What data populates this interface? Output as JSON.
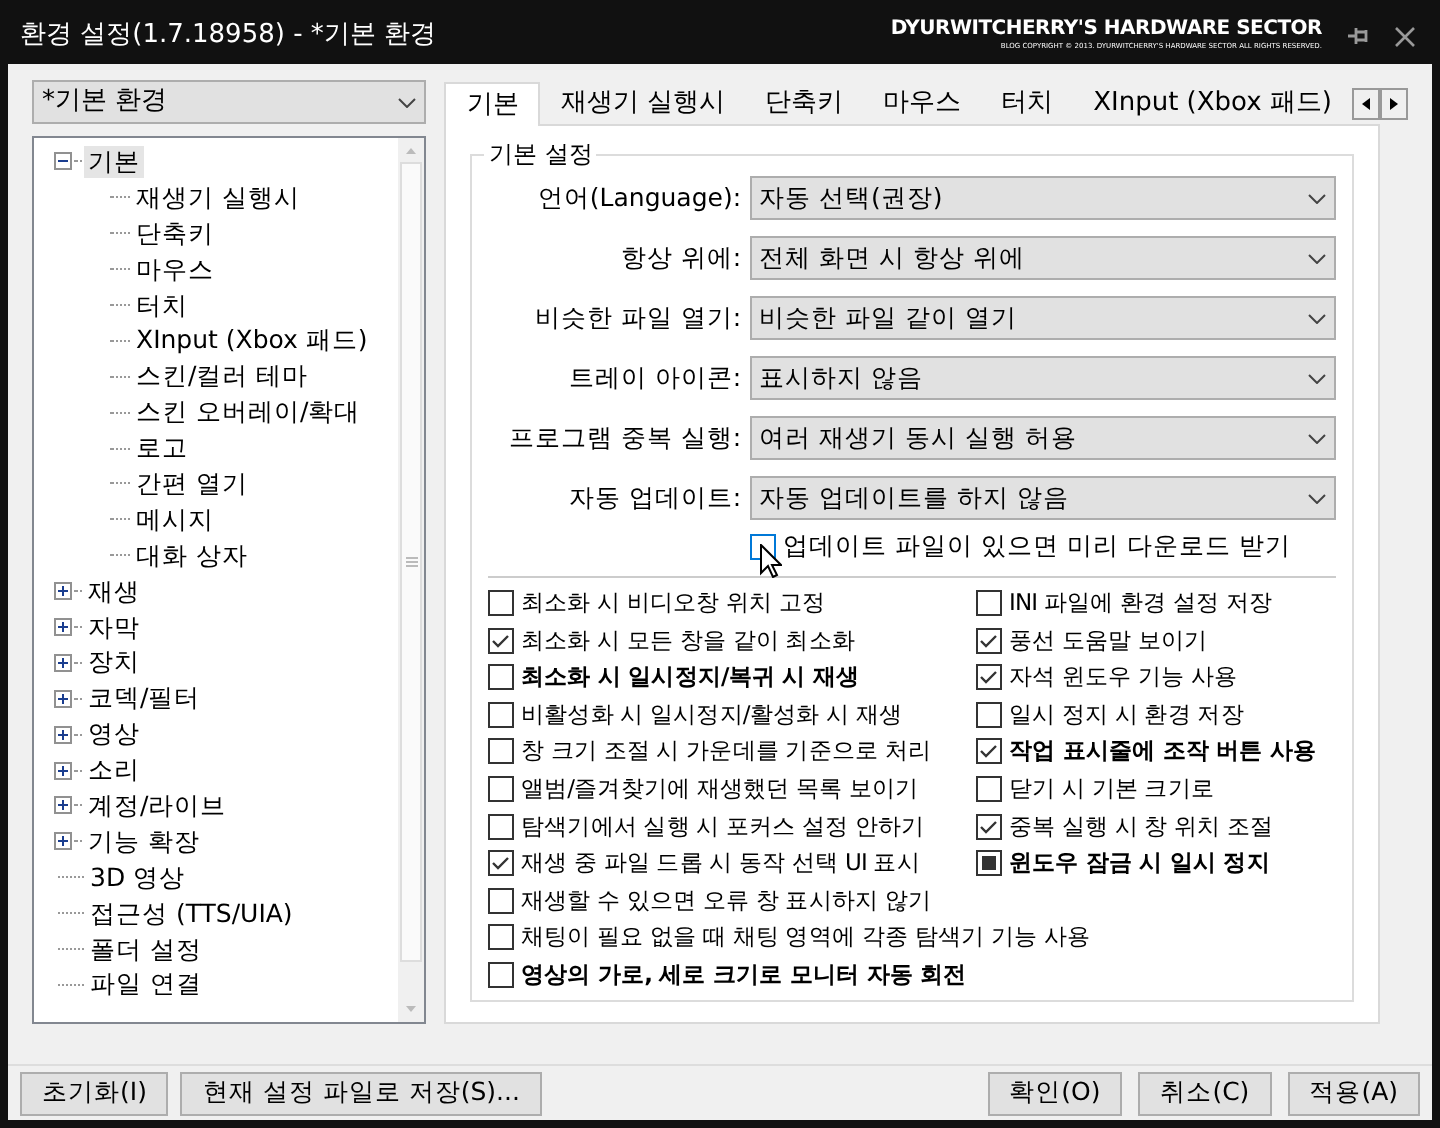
{
  "window": {
    "title": "환경 설정(1.7.18958) - *기본 환경",
    "logo": {
      "name": "DYURWITCHERRY'S HARDWARE SECTOR",
      "tagline": "BLOG COPYRIGHT © 2013. DYURWITCHERRY'S HARDWARE SECTOR ALL RIGHTS RESERVED."
    }
  },
  "profile": {
    "value": "*기본 환경"
  },
  "tree": [
    {
      "label": "기본",
      "selected": true,
      "expanded": true,
      "children": [
        {
          "label": "재생기 실행시",
          "selected": false
        },
        {
          "label": "단축키",
          "selected": false
        },
        {
          "label": "마우스",
          "selected": false
        },
        {
          "label": "터치",
          "selected": false
        },
        {
          "label": "XInput (Xbox 패드)",
          "selected": false
        },
        {
          "label": "스킨/컬러 테마",
          "selected": false
        },
        {
          "label": "스킨 오버레이/확대",
          "selected": false
        },
        {
          "label": "로고",
          "selected": false
        },
        {
          "label": "간편 열기",
          "selected": false
        },
        {
          "label": "메시지",
          "selected": false
        },
        {
          "label": "대화 상자",
          "selected": false
        }
      ]
    },
    {
      "label": "재생",
      "selected": false,
      "expanded": false
    },
    {
      "label": "자막",
      "selected": false,
      "expanded": false
    },
    {
      "label": "장치",
      "selected": false,
      "expanded": false
    },
    {
      "label": "코덱/필터",
      "selected": false,
      "expanded": false
    },
    {
      "label": "영상",
      "selected": false,
      "expanded": false
    },
    {
      "label": "소리",
      "selected": false,
      "expanded": false
    },
    {
      "label": "계정/라이브",
      "selected": false,
      "expanded": false
    },
    {
      "label": "기능 확장",
      "selected": false,
      "expanded": false
    },
    {
      "label": "3D 영상",
      "selected": false
    },
    {
      "label": "접근성 (TTS/UIA)",
      "selected": false
    },
    {
      "label": "폴더 설정",
      "selected": false
    },
    {
      "label": "파일 연결",
      "selected": false
    }
  ],
  "tabs": [
    {
      "label": "기본",
      "selected": true
    },
    {
      "label": "재생기 실행시",
      "selected": false
    },
    {
      "label": "단축키",
      "selected": false
    },
    {
      "label": "마우스",
      "selected": false
    },
    {
      "label": "터치",
      "selected": false
    },
    {
      "label": "XInput (Xbox 패드)",
      "selected": false
    }
  ],
  "group": {
    "title": "기본 설정"
  },
  "settings": [
    {
      "label": "언어(Language):",
      "value": "자동 선택(권장)"
    },
    {
      "label": "항상 위에:",
      "value": "전체 화면 시 항상 위에"
    },
    {
      "label": "비슷한 파일 열기:",
      "value": "비슷한 파일 같이 열기"
    },
    {
      "label": "트레이 아이콘:",
      "value": "표시하지 않음"
    },
    {
      "label": "프로그램 중복 실행:",
      "value": "여러 재생기 동시 실행 허용"
    },
    {
      "label": "자동 업데이트:",
      "value": "자동 업데이트를 하지 않음"
    }
  ],
  "update_option": {
    "label": "업데이트 파일이 있으면 미리 다운로드 받기",
    "checked": false,
    "hovered": true
  },
  "options": [
    {
      "label": "최소화 시 비디오창 위치 고정",
      "checked": false,
      "indeterminate": false,
      "bold": false,
      "kind": "half"
    },
    {
      "label": "INI 파일에 환경 설정 저장",
      "checked": false,
      "indeterminate": false,
      "bold": false,
      "kind": "half"
    },
    {
      "label": "최소화 시 모든 창을 같이 최소화",
      "checked": true,
      "indeterminate": false,
      "bold": false,
      "kind": "half"
    },
    {
      "label": "풍선 도움말 보이기",
      "checked": true,
      "indeterminate": false,
      "bold": false,
      "kind": "half"
    },
    {
      "label": "최소화 시 일시정지/복귀 시 재생",
      "checked": false,
      "indeterminate": false,
      "bold": true,
      "kind": "half"
    },
    {
      "label": "자석 윈도우 기능 사용",
      "checked": true,
      "indeterminate": false,
      "bold": false,
      "kind": "half"
    },
    {
      "label": "비활성화 시 일시정지/활성화 시 재생",
      "checked": false,
      "indeterminate": false,
      "bold": false,
      "kind": "half"
    },
    {
      "label": "일시 정지 시 환경 저장",
      "checked": false,
      "indeterminate": false,
      "bold": false,
      "kind": "half"
    },
    {
      "label": "창 크기 조절 시 가운데를 기준으로 처리",
      "checked": false,
      "indeterminate": false,
      "bold": false,
      "kind": "half"
    },
    {
      "label": "작업 표시줄에 조작 버튼 사용",
      "checked": true,
      "indeterminate": false,
      "bold": true,
      "kind": "half"
    },
    {
      "label": "앨범/즐겨찾기에 재생했던 목록 보이기",
      "checked": false,
      "indeterminate": false,
      "bold": false,
      "kind": "half"
    },
    {
      "label": "닫기 시 기본 크기로",
      "checked": false,
      "indeterminate": false,
      "bold": false,
      "kind": "half"
    },
    {
      "label": "탐색기에서 실행 시 포커스 설정 안하기",
      "checked": false,
      "indeterminate": false,
      "bold": false,
      "kind": "half"
    },
    {
      "label": "중복 실행 시 창 위치 조절",
      "checked": true,
      "indeterminate": false,
      "bold": false,
      "kind": "half"
    },
    {
      "label": "재생 중 파일 드롭 시 동작 선택 UI 표시",
      "checked": true,
      "indeterminate": false,
      "bold": false,
      "kind": "half"
    },
    {
      "label": "윈도우 잠금 시 일시 정지",
      "checked": false,
      "indeterminate": true,
      "bold": true,
      "kind": "half"
    },
    {
      "label": "재생할 수 있으면 오류 창 표시하지 않기",
      "checked": false,
      "indeterminate": false,
      "bold": false,
      "kind": "full"
    },
    {
      "label": "채팅이 필요 없을 때 채팅 영역에 각종 탐색기 기능 사용",
      "checked": false,
      "indeterminate": false,
      "bold": false,
      "kind": "full"
    },
    {
      "label": "영상의 가로, 세로 크기로 모니터 자동 회전",
      "checked": false,
      "indeterminate": false,
      "bold": true,
      "kind": "full"
    }
  ],
  "footer_left": [
    {
      "label": "초기화(I)"
    },
    {
      "label": "현재 설정 파일로 저장(S)..."
    }
  ],
  "footer_right": [
    {
      "label": "확인(O)"
    },
    {
      "label": "취소(C)"
    },
    {
      "label": "적용(A)"
    }
  ]
}
